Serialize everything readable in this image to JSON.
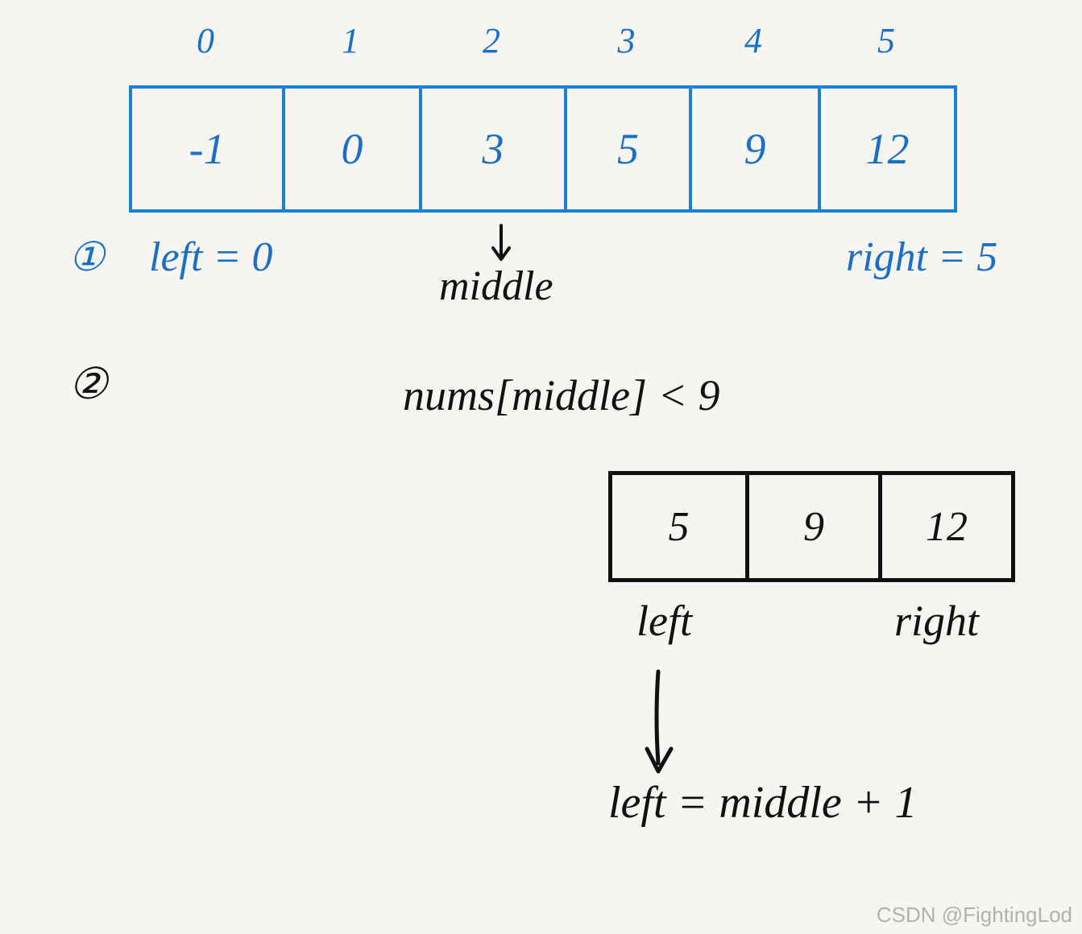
{
  "indices": [
    "0",
    "1",
    "2",
    "3",
    "4",
    "5"
  ],
  "array": [
    "-1",
    "0",
    "3",
    "5",
    "9",
    "12"
  ],
  "step1": {
    "marker": "①",
    "left": "left = 0",
    "right": "right = 5",
    "middle": "middle"
  },
  "step2": {
    "marker": "②",
    "condition": "nums[middle] < 9",
    "sub_array": [
      "5",
      "9",
      "12"
    ],
    "sub_left": "left",
    "sub_right": "right",
    "left_assign": "left = middle + 1"
  },
  "watermark": "CSDN @FightingLod"
}
